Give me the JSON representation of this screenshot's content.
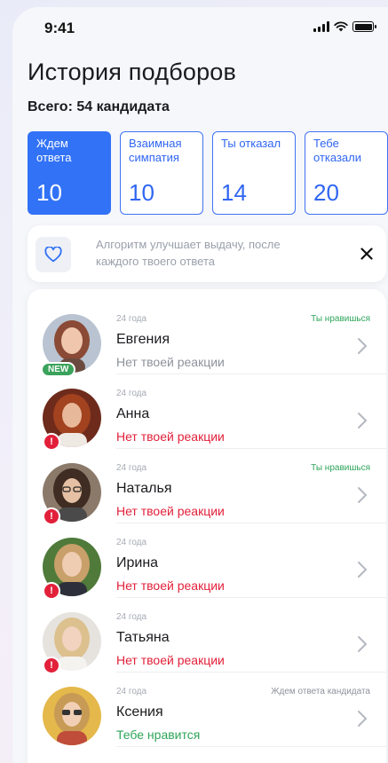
{
  "status_bar": {
    "time": "9:41"
  },
  "title": "История подборов",
  "total": "Всего: 54 кандидата",
  "stats": [
    {
      "label": "Ждем ответа",
      "value": "10",
      "active": true
    },
    {
      "label": "Взаимная симпатия",
      "value": "10",
      "active": false
    },
    {
      "label": "Ты отказал",
      "value": "14",
      "active": false
    },
    {
      "label": "Тебе отказали",
      "value": "20",
      "active": false
    }
  ],
  "info": {
    "text": "Алгоритм улучшает выдачу, после каждого твоего ответа",
    "icon": "heart-icon",
    "close_icon": "close-icon"
  },
  "candidates": [
    {
      "age": "24 года",
      "name": "Евгения",
      "reaction": "Нет твоей реакции",
      "reaction_color": "gray",
      "status": "Ты нравишься",
      "status_color": "green",
      "badge": "NEW"
    },
    {
      "age": "24 года",
      "name": "Анна",
      "reaction": "Нет твоей реакции",
      "reaction_color": "red",
      "status": "",
      "status_color": "green",
      "badge": "!"
    },
    {
      "age": "24 года",
      "name": "Наталья",
      "reaction": "Нет твоей реакции",
      "reaction_color": "red",
      "status": "Ты нравишься",
      "status_color": "green",
      "badge": "!"
    },
    {
      "age": "24 года",
      "name": "Ирина",
      "reaction": "Нет твоей реакции",
      "reaction_color": "red",
      "status": "",
      "status_color": "green",
      "badge": "!"
    },
    {
      "age": "24 года",
      "name": "Татьяна",
      "reaction": "Нет твоей реакции",
      "reaction_color": "red",
      "status": "",
      "status_color": "green",
      "badge": "!"
    },
    {
      "age": "24 года",
      "name": "Ксения",
      "reaction": "Тебе нравится",
      "reaction_color": "green",
      "status": "Ждем ответа кандидата",
      "status_color": "gray",
      "badge": ""
    }
  ],
  "colors": {
    "accent": "#3272f6",
    "alert": "#e2203a",
    "success": "#2ea55a"
  }
}
